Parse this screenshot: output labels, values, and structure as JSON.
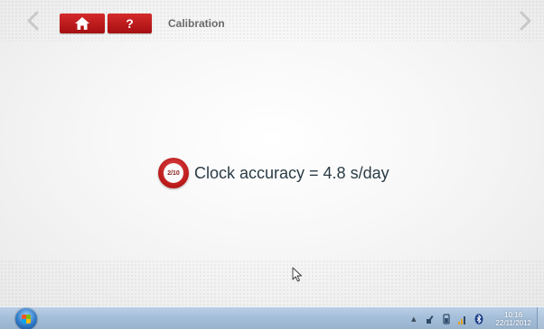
{
  "header": {
    "title": "Calibration",
    "help_label": "?",
    "prev_icon": "chevron-left-icon",
    "next_icon": "chevron-right-icon",
    "home_icon": "home-icon"
  },
  "message": {
    "step_badge": "2/10",
    "text": "Clock accuracy = 4.8 s/day"
  },
  "taskbar": {
    "clock_time": "10:16",
    "clock_date": "22/11/2012"
  },
  "colors": {
    "accent_red": "#c01d1d",
    "title_gray": "#6a6a6a",
    "message_text": "#2b3b45"
  }
}
